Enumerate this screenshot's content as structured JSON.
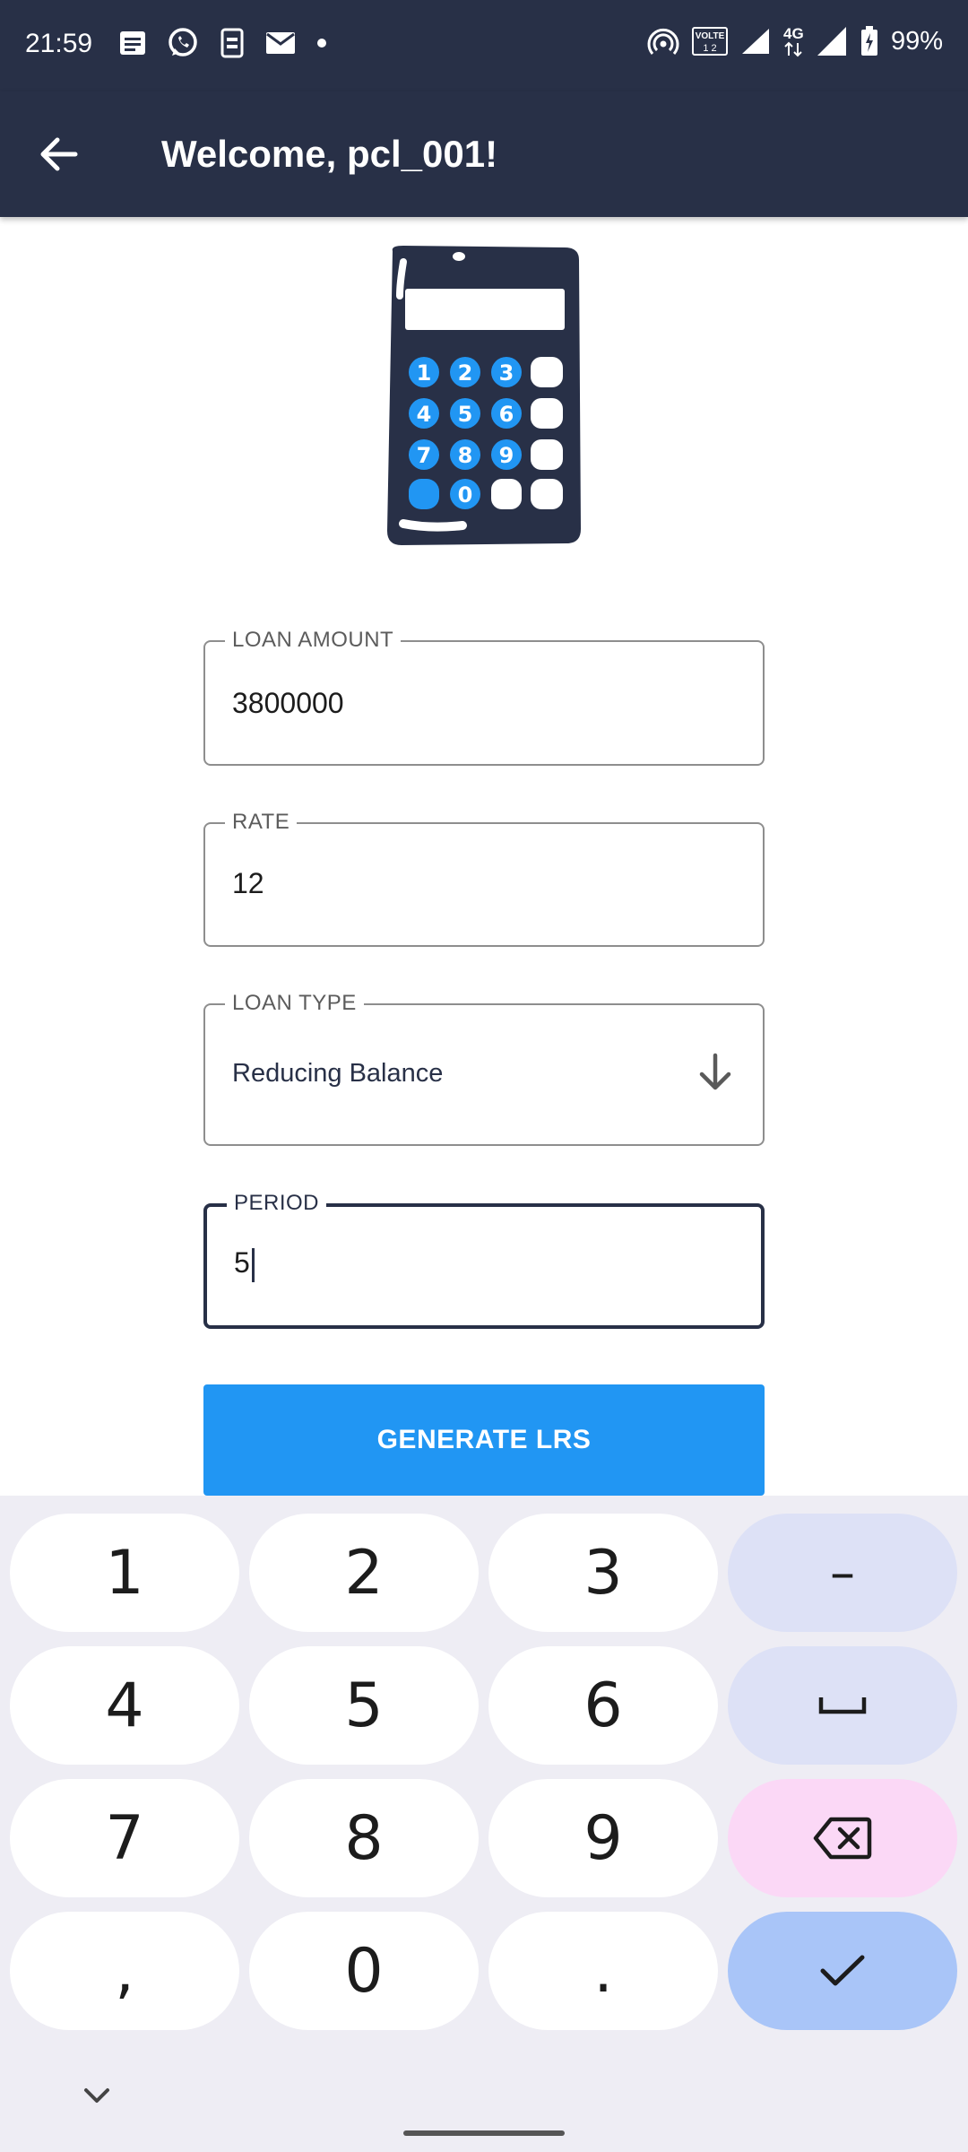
{
  "status_bar": {
    "time": "21:59",
    "network": "4G",
    "volte": "VOLTE",
    "battery": "99%",
    "left_icons": [
      "message-icon",
      "whatsapp-icon",
      "sim-toolkit-icon",
      "mail-icon",
      "dot-icon"
    ],
    "right_icons": [
      "hotspot-icon",
      "volte-icon",
      "signal-icon",
      "signal-4g-icon",
      "battery-icon"
    ]
  },
  "app_bar": {
    "title": "Welcome, pcl_001!",
    "back_icon": "arrow-left-icon"
  },
  "logo": {
    "icon": "calculator-icon"
  },
  "form": {
    "loan_amount": {
      "label": "LOAN AMOUNT",
      "value": "3800000"
    },
    "rate": {
      "label": "RATE",
      "value": "12"
    },
    "loan_type": {
      "label": "LOAN TYPE",
      "value": "Reducing Balance",
      "icon": "arrow-down-icon"
    },
    "period": {
      "label": "PERIOD",
      "value": "5"
    },
    "submit_label": "GENERATE LRS"
  },
  "keyboard": {
    "rows": [
      [
        "1",
        "2",
        "3",
        "–"
      ],
      [
        "4",
        "5",
        "6",
        "space"
      ],
      [
        "7",
        "8",
        "9",
        "backspace"
      ],
      [
        ",",
        "0",
        ".",
        "done"
      ]
    ],
    "k1": "1",
    "k2": "2",
    "k3": "3",
    "kdash": "–",
    "k4": "4",
    "k5": "5",
    "k6": "6",
    "k7": "7",
    "k8": "8",
    "k9": "9",
    "kcomma": ",",
    "k0": "0",
    "kdot": ".",
    "collapse_icon": "chevron-down-icon"
  },
  "colors": {
    "app_bar": "#283047",
    "primary_button": "#2196f3",
    "keyboard_bg": "#eeedf4",
    "key_fn": "#dde1f6",
    "key_delete": "#fbd8f6",
    "key_done": "#a9c5f8"
  }
}
